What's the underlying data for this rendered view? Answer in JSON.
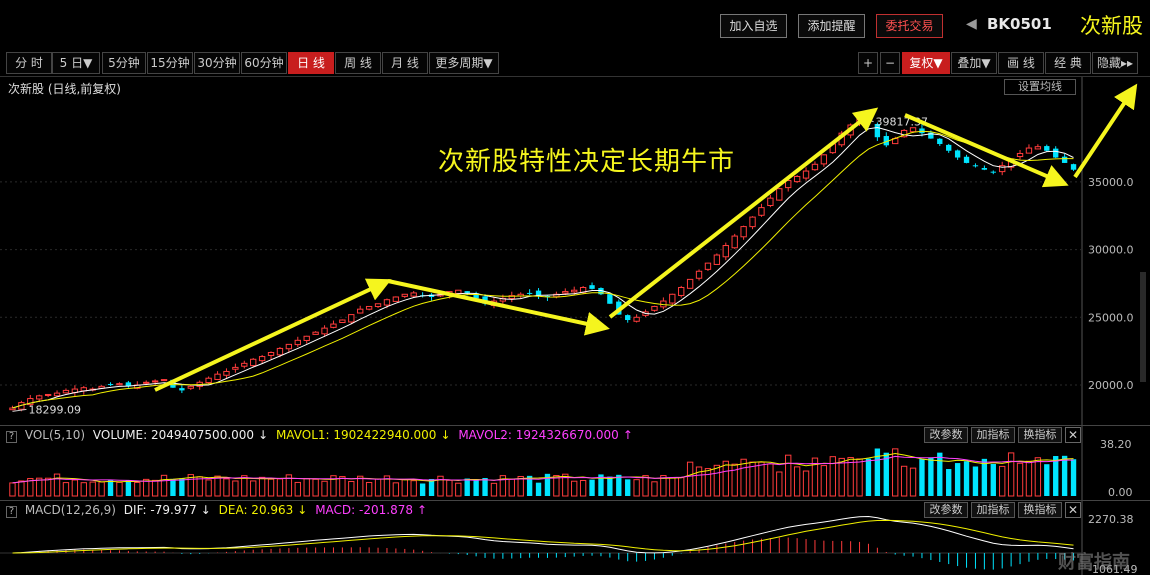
{
  "topbar": {
    "add_watchlist": "加入自选",
    "add_alert": "添加提醒",
    "entrust_trade": "委托交易",
    "code": "BK0501",
    "name": "次新股"
  },
  "toolbar": {
    "periods": [
      "分 时",
      "5 日▼",
      "5分钟",
      "15分钟",
      "30分钟",
      "60分钟",
      "日 线",
      "周 线",
      "月 线",
      "更多周期▼"
    ],
    "active_period": "日 线",
    "right_buttons": [
      "+",
      "−",
      "复权▼",
      "叠加▼",
      "画 线",
      "经 典",
      "隐藏▸▸"
    ]
  },
  "main_chart": {
    "title": "次新股 (日线,前复权)",
    "ma_settings": "设置均线",
    "annotation": "次新股特性决定长期牛市",
    "high_label": "39817.37",
    "low_label": "18299.09",
    "y_ticks": [
      "35000.0",
      "30000.0",
      "25000.0",
      "20000.0"
    ]
  },
  "volume": {
    "name": "VOL(5,10)",
    "volume_label": "VOLUME: 2049407500.000",
    "mavol1_label": "MAVOL1: 1902422940.000",
    "mavol2_label": "MAVOL2: 1924326670.000",
    "y_top": "38.20",
    "y_bottom": "0.00",
    "buttons": [
      "改参数",
      "加指标",
      "换指标"
    ]
  },
  "macd": {
    "name": "MACD(12,26,9)",
    "dif_label": "DIF: -79.977",
    "dea_label": "DEA: 20.963",
    "macd_label": "MACD: -201.878",
    "y_top": "2270.38",
    "y_bottom": "-1061.49",
    "buttons": [
      "改参数",
      "加指标",
      "换指标"
    ]
  },
  "colors": {
    "up": "#ff3c3c",
    "down": "#00e5ff",
    "ma_yellow": "#f0f000",
    "ma_magenta": "#ff40ff",
    "annotation": "#f5f51e"
  },
  "watermark": "财富指南",
  "chart_data": {
    "type": "candlestick",
    "y_ticks": [
      35000,
      30000,
      25000,
      20000
    ],
    "high": 39817.37,
    "low": 18299.09,
    "close_series": [
      18300,
      18700,
      19000,
      19200,
      19300,
      19400,
      19600,
      19700,
      19800,
      19700,
      19900,
      20000,
      20100,
      19900,
      20000,
      20200,
      20300,
      20400,
      19800,
      19600,
      19900,
      20200,
      20500,
      20800,
      21000,
      21300,
      21600,
      21900,
      22100,
      22400,
      22700,
      23000,
      23300,
      23600,
      23900,
      24200,
      24500,
      24800,
      25200,
      25600,
      25800,
      26000,
      26300,
      26500,
      26700,
      26800,
      26600,
      26500,
      26700,
      26900,
      27000,
      26800,
      26400,
      26000,
      26200,
      26400,
      26600,
      26700,
      26800,
      26600,
      26500,
      26700,
      26900,
      27000,
      27200,
      27100,
      26700,
      26000,
      25200,
      24800,
      25000,
      25400,
      25800,
      26200,
      26700,
      27200,
      27800,
      28400,
      29000,
      29600,
      30300,
      31000,
      31700,
      32400,
      33100,
      33800,
      34500,
      35100,
      35400,
      35800,
      36300,
      37000,
      37800,
      38600,
      39200,
      39600,
      39400,
      38300,
      37700,
      38200,
      38800,
      39000,
      38600,
      38200,
      37800,
      37300,
      36800,
      36400,
      36200,
      35900,
      35700,
      36200,
      36700,
      37100,
      37500,
      37600,
      37300,
      36800,
      36400,
      35900
    ]
  }
}
